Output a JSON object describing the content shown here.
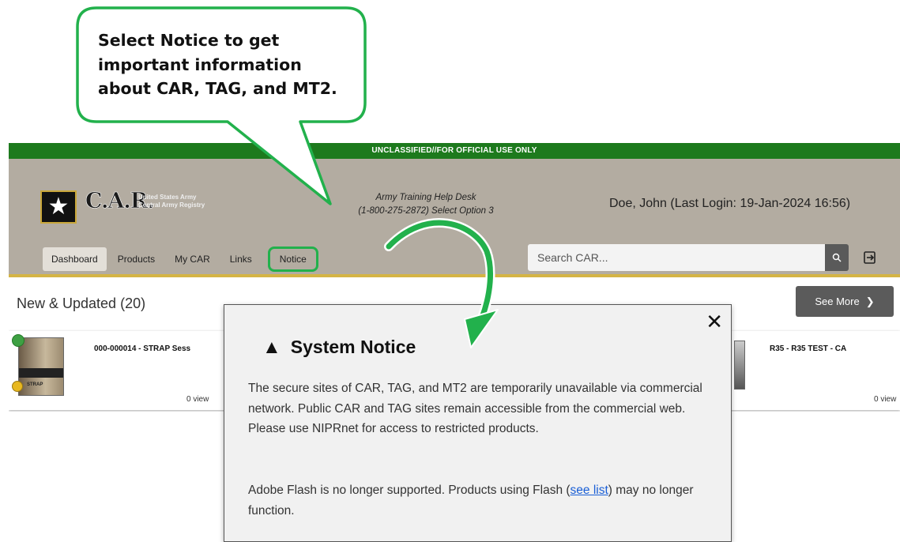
{
  "callout": {
    "text": "Select Notice to get important information about CAR, TAG, and MT2."
  },
  "banner": {
    "classification": "UNCLASSIFIED//FOR OFFICIAL USE ONLY"
  },
  "header": {
    "logo_text": "C.A.R.",
    "logo_subtitle_line1": "United States Army",
    "logo_subtitle_line2": "Central Army Registry",
    "helpdesk_line1": "Army Training Help Desk",
    "helpdesk_line2": "(1-800-275-2872) Select Option 3",
    "user": "Doe, John (Last Login: 19-Jan-2024 16:56)"
  },
  "nav": {
    "dashboard": "Dashboard",
    "products": "Products",
    "my_car": "My CAR",
    "links": "Links",
    "notice": "Notice"
  },
  "search": {
    "placeholder": "Search CAR..."
  },
  "section": {
    "title": "New & Updated (20)",
    "see_more": "See More"
  },
  "cards": [
    {
      "title": "000-000014 - STRAP Sess",
      "thumb_label": "STRAP",
      "views": "0 view"
    },
    {
      "title": "R35 - R35 TEST - CA",
      "views": "0 view"
    }
  ],
  "modal": {
    "title": "System Notice",
    "para1": "The secure sites of CAR, TAG, and MT2 are temporarily unavailable via commercial network. Public CAR and TAG sites remain accessible from the commercial web. Please use NIPRnet for access to restricted products.",
    "para2_before": "Adobe Flash is no longer supported. Products using Flash (",
    "para2_link": "see list",
    "para2_after": ") may no longer function."
  },
  "colors": {
    "classification_green": "#1d7a1d",
    "header_bg": "#b3aca1",
    "callout_green": "#22b14c",
    "link_blue": "#1a5fd6"
  }
}
